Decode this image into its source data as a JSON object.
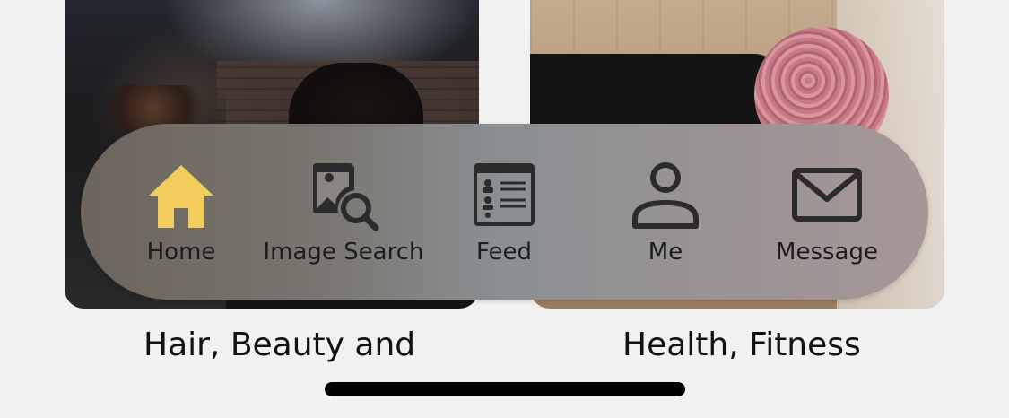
{
  "cards": [
    {
      "title": "Hair, Beauty and"
    },
    {
      "title": "Health, Fitness"
    }
  ],
  "tabbar": {
    "active_color": "#f2cd5c",
    "icon_color": "#2b2b2b",
    "tabs": [
      {
        "label": "Home",
        "icon": "home-icon",
        "active": true
      },
      {
        "label": "Image Search",
        "icon": "image-search-icon",
        "active": false
      },
      {
        "label": "Feed",
        "icon": "feed-icon",
        "active": false
      },
      {
        "label": "Me",
        "icon": "person-icon",
        "active": false
      },
      {
        "label": "Message",
        "icon": "envelope-icon",
        "active": false
      }
    ]
  }
}
